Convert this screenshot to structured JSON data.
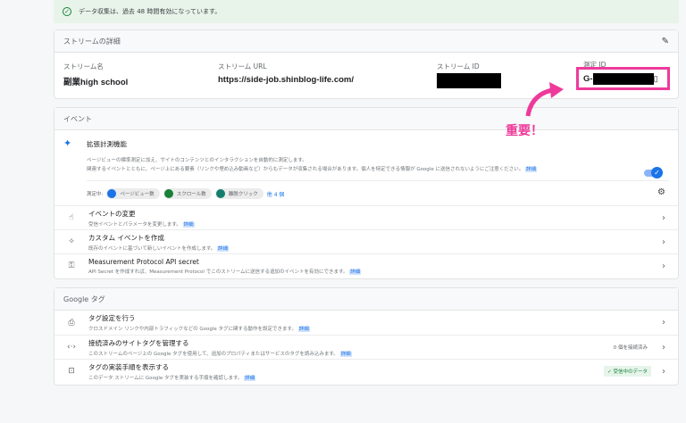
{
  "banner": {
    "text": "データ収集は、過去 48 時間有効になっています。"
  },
  "stream": {
    "title": "ストリームの詳細",
    "name_label": "ストリーム名",
    "name": "副業high school",
    "url_label": "ストリーム URL",
    "url": "https://side-job.shinblog-life.com/",
    "id_label": "ストリーム ID",
    "mid_label": "測定 ID",
    "mid_prefix": "G-"
  },
  "annotation": {
    "text": "重要！",
    "color": "#ee3a9a"
  },
  "events": {
    "title": "イベント",
    "enhanced": {
      "title": "拡張計測機能",
      "desc1": "ページビューの標準測定に加え、サイトのコンテンツとのインタラクションを自動的に測定します。",
      "desc2": "関連するイベントとともに、ページ上にある要素（リンクや埋め込み動画など）からもデータが収集される場合があります。個人を特定できる情報が Google に送信されないようにご注意ください。",
      "link": "詳細",
      "measuring": "測定中:",
      "chips": [
        "ページビュー数",
        "スクロール数",
        "離脱クリック"
      ],
      "more": "他 4 個",
      "enabled": true
    },
    "rows": [
      {
        "title": "イベントの変更",
        "desc": "受信イベントとパラメータを変更します。",
        "link": "詳細",
        "icon": "touch-icon"
      },
      {
        "title": "カスタム イベントを作成",
        "desc": "既存のイベントに基づいて新しいイベントを作成します。",
        "link": "詳細",
        "icon": "sparkle-click-icon"
      },
      {
        "title": "Measurement Protocol API secret",
        "desc": "API Secret を作成すれば、Measurement Protocol でこのストリームに送信する追加のイベントを有効にできます。",
        "link": "詳細",
        "icon": "key-icon"
      }
    ]
  },
  "gtag": {
    "title": "Google タグ",
    "rows": [
      {
        "title": "タグ設定を行う",
        "desc": "クロスドメイン リンクや内部トラフィックなどの Google タグに関する動作を設定できます。",
        "link": "詳細",
        "badge": ""
      },
      {
        "title": "接続済みのサイトタグを管理する",
        "desc": "このストリームのページ上の Google タグを使用して、追加のプロパティまたはサービスのタグを読み込みます。",
        "link": "詳細",
        "badge": "0 個を接続済み"
      },
      {
        "title": "タグの実装手順を表示する",
        "desc": "このデータ ストリームに Google タグを実装する手順を確認します。",
        "link": "詳細",
        "badge": "✓ 受信中のデータ"
      }
    ]
  }
}
